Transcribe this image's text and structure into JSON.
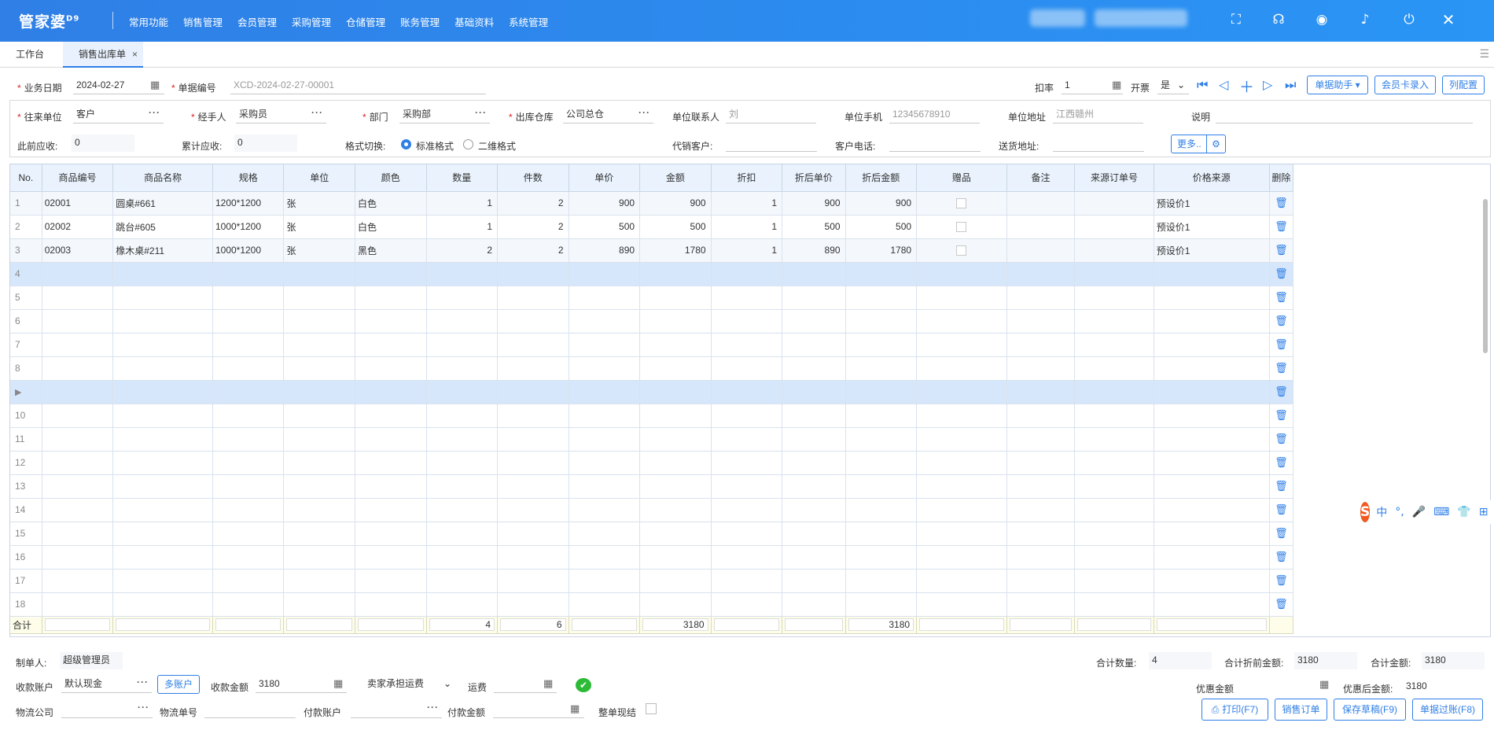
{
  "app": {
    "logo": "管家婆",
    "logo_sup": "D9",
    "nav": [
      "常用功能",
      "销售管理",
      "会员管理",
      "采购管理",
      "仓储管理",
      "账务管理",
      "基础资料",
      "系统管理"
    ]
  },
  "tabs": [
    {
      "label": "工作台",
      "active": false
    },
    {
      "label": "销售出库单",
      "active": true,
      "close": "×"
    }
  ],
  "form": {
    "biz_date_label": "业务日期",
    "biz_date": "2024-02-27",
    "doc_no_label": "单据编号",
    "doc_no": "XCD-2024-02-27-00001",
    "rate_label": "扣率",
    "rate": "1",
    "invoice_label": "开票",
    "invoice": "是",
    "helper_btn": "单据助手 ▾",
    "member_card_btn": "会员卡录入",
    "col_config_btn": "列配置",
    "partner_label": "往来单位",
    "partner": "客户",
    "handler_label": "经手人",
    "handler": "采购员",
    "dept_label": "部门",
    "dept": "采购部",
    "warehouse_label": "出库仓库",
    "warehouse": "公司总仓",
    "contact_label": "单位联系人",
    "contact": "刘",
    "phone_label": "单位手机",
    "phone": "12345678910",
    "address_label": "单位地址",
    "address": "江西赣州",
    "note_label": "说明",
    "note": "",
    "prev_recv_label": "此前应收:",
    "prev_recv": "0",
    "total_recv_label": "累计应收:",
    "total_recv": "0",
    "format_label": "格式切换:",
    "format_std": "标准格式",
    "format_2d": "二维格式",
    "agent_label": "代销客户:",
    "agent": "",
    "cust_phone_label": "客户电话:",
    "cust_phone": "",
    "delivery_label": "送货地址:",
    "delivery": "",
    "more_btn": "更多.."
  },
  "grid": {
    "columns": [
      "No.",
      "商品编号",
      "商品名称",
      "规格",
      "单位",
      "颜色",
      "数量",
      "件数",
      "单价",
      "金额",
      "折扣",
      "折后单价",
      "折后金额",
      "赠品",
      "备注",
      "来源订单号",
      "价格来源",
      "删除"
    ],
    "rows": [
      {
        "no": "1",
        "code": "02001",
        "name": "圆桌#661",
        "spec": "1200*1200",
        "unit": "张",
        "color": "白色",
        "qty": "1",
        "pieces": "2",
        "price": "900",
        "amount": "900",
        "discount": "1",
        "dprice": "900",
        "damount": "900",
        "gift": false,
        "remark": "",
        "src": "",
        "price_src": "预设价1"
      },
      {
        "no": "2",
        "code": "02002",
        "name": "跳台#605",
        "spec": "1000*1200",
        "unit": "张",
        "color": "白色",
        "qty": "1",
        "pieces": "2",
        "price": "500",
        "amount": "500",
        "discount": "1",
        "dprice": "500",
        "damount": "500",
        "gift": false,
        "remark": "",
        "src": "",
        "price_src": "预设价1"
      },
      {
        "no": "3",
        "code": "02003",
        "name": "橡木桌#211",
        "spec": "1000*1200",
        "unit": "张",
        "color": "黑色",
        "qty": "2",
        "pieces": "2",
        "price": "890",
        "amount": "1780",
        "discount": "1",
        "dprice": "890",
        "damount": "1780",
        "gift": false,
        "remark": "",
        "src": "",
        "price_src": "预设价1"
      }
    ],
    "empty_rows": [
      "4",
      "5",
      "6",
      "7",
      "8",
      "▶",
      "10",
      "11",
      "12",
      "13",
      "14",
      "15",
      "16",
      "17",
      "18"
    ],
    "sum_label": "合计",
    "sum_qty": "4",
    "sum_pieces": "6",
    "sum_amount": "3180",
    "sum_damount": "3180"
  },
  "ime": {
    "logo": "S",
    "items": [
      "中",
      "°,",
      "🎤",
      "⌨",
      "👕",
      "⊞"
    ]
  },
  "footer": {
    "maker_label": "制单人:",
    "maker": "超级管理员",
    "total_qty_label": "合计数量:",
    "total_qty": "4",
    "pre_disc_label": "合计折前金额:",
    "pre_disc": "3180",
    "total_amount_label": "合计金额:",
    "total_amount": "3180",
    "recv_account_label": "收款账户",
    "recv_account": "默认现金",
    "multi_account_btn": "多账户",
    "recv_amount_label": "收款金额",
    "recv_amount": "3180",
    "freight_type": "卖家承担运费",
    "freight_label": "运费",
    "freight": "",
    "discount_amt_label": "优惠金额",
    "discount_amt": "",
    "after_disc_label": "优惠后金额:",
    "after_disc": "3180",
    "logistics_label": "物流公司",
    "logistics": "",
    "tracking_label": "物流单号",
    "tracking": "",
    "pay_account_label": "付款账户",
    "pay_account": "",
    "pay_amount_label": "付款金额",
    "pay_amount": "",
    "whole_cash_label": "整单现结",
    "print_btn": "打印(F7)",
    "sales_order_btn": "销售订单",
    "save_draft_btn": "保存草稿(F9)",
    "post_btn": "单据过账(F8)"
  }
}
